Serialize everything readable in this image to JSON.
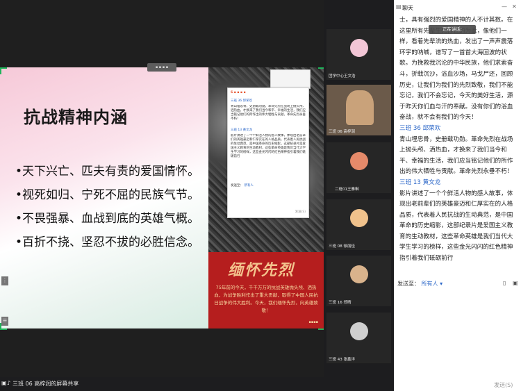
{
  "slide": {
    "title": "抗战精神内涵",
    "bullets": [
      "•天下兴亡、匹夫有责的爱国情怀。",
      "•视死如归、宁死不屈的民族气节。",
      "•不畏强暴、血战到底的英雄气概。",
      "•百折不挠、坚忍不拔的必胜信念。"
    ],
    "banner_title": "缅怀先烈",
    "banner_text": "75年前的今天，千千万万的抗战英雄抛头颅、洒热血，为战争胜利作出了重大贡献，取得了中国人民抗日战争的伟大胜利。今天，我们缅怀先烈，向英雄致敬！"
  },
  "status_bar": {
    "screen_share_label": "三班 06 高梓润的屏幕共享"
  },
  "video_tiles": [
    {
      "name": "团学中心王文浩",
      "avatar_color": "#f2c6d6"
    },
    {
      "name": "三班 06 高梓润",
      "avatar_color": "#c9a27a"
    },
    {
      "name": "二班01王雅琳",
      "avatar_color": "#e58a6a"
    },
    {
      "name": "三班 08 徐丽佳",
      "avatar_color": "#f0c28c"
    },
    {
      "name": "三班 16 郑晴",
      "avatar_color": "#d9b38c"
    },
    {
      "name": "三班 43 张鑫洋",
      "avatar_color": "#cfcfcf"
    }
  ],
  "chat": {
    "title": "聊天",
    "speaking_indicator": "正在讲话:",
    "message_intro": "士，具有强烈的爱国精神的人不计其数。在这里所有先辈生死存亡的为此，像他们一样，看着先辈流的热血，发出了一声声震落环宇的呐喊，谱写了一首首大海回波的状歌。为挽救我沉沦的中华民族，他们求索奋斗，折戟沉沙，浴血沙场，马戈尸还，回顾历史，让我们为我们的先烈致敬，我们不能忘记，我们不会忘记，今天的美好生活，源于昨天你们血与汗的奉献。没有你们的浴血奋战，就不会有我们的今天！",
    "messages": [
      {
        "sender": "三班 36 邱荣欢",
        "text": "青山埋忠骨，史册载功勋。革命先烈在战场上抛头颅、洒热血，才换来了我们当今和平、幸福的生活，我们应当铭记他们的所作出的伟大牺牲与贡献。革命先烈永垂不朽！"
      },
      {
        "sender": "三班 13 黄文龙",
        "text": "影片讲述了一个个鲜活人物的感人故事，体现出老前辈们的英雄豪迈和仁厚实在的人格品质，代表着人民抗战的生动典范，是中国革命的历史缩影，这部纪录片是爱国主义教育的生动教材，这些革命英雄是我们当代大学生学习的榜样，这些金光闪闪的红色精神指引着我们砥砺前行"
      }
    ],
    "send_label": "发送至：",
    "send_target": "所有人",
    "send_button": "发送(S)"
  },
  "colors": {
    "accent_green": "#1fb45a",
    "link_blue": "#2a66c8",
    "banner_red": "#b51e1e"
  }
}
